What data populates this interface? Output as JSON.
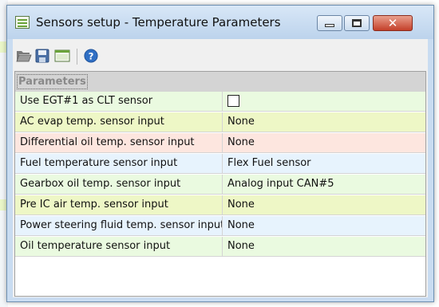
{
  "window": {
    "title": "Sensors setup - Temperature Parameters"
  },
  "toolbar": {
    "icons": [
      "open-folder-icon",
      "save-icon",
      "window-icon",
      "help-icon"
    ]
  },
  "grid": {
    "category": "Parameters",
    "rows": [
      {
        "name": "Use EGT#1 as CLT sensor",
        "value": "",
        "type": "checkbox",
        "checked": false,
        "color": "#eafae0"
      },
      {
        "name": "AC evap temp. sensor input",
        "value": "None",
        "type": "text",
        "color": "#eef7c6"
      },
      {
        "name": "Differential oil temp. sensor input",
        "value": "None",
        "type": "text",
        "color": "#fde6df"
      },
      {
        "name": "Fuel temperature sensor input",
        "value": "Flex Fuel sensor",
        "type": "text",
        "color": "#e7f3fd"
      },
      {
        "name": "Gearbox oil temp. sensor input",
        "value": "Analog input CAN#5",
        "type": "text",
        "color": "#eafae0"
      },
      {
        "name": "Pre IC air temp. sensor input",
        "value": "None",
        "type": "text",
        "color": "#eef7c6"
      },
      {
        "name": "Power steering fluid temp. sensor input",
        "value": "None",
        "type": "text",
        "color": "#e7f3fd"
      },
      {
        "name": "Oil temperature sensor input",
        "value": "None",
        "type": "text",
        "color": "#eafae0"
      }
    ]
  },
  "colors": {
    "accent_close": "#c4402a",
    "help_blue": "#2f6fc4"
  }
}
